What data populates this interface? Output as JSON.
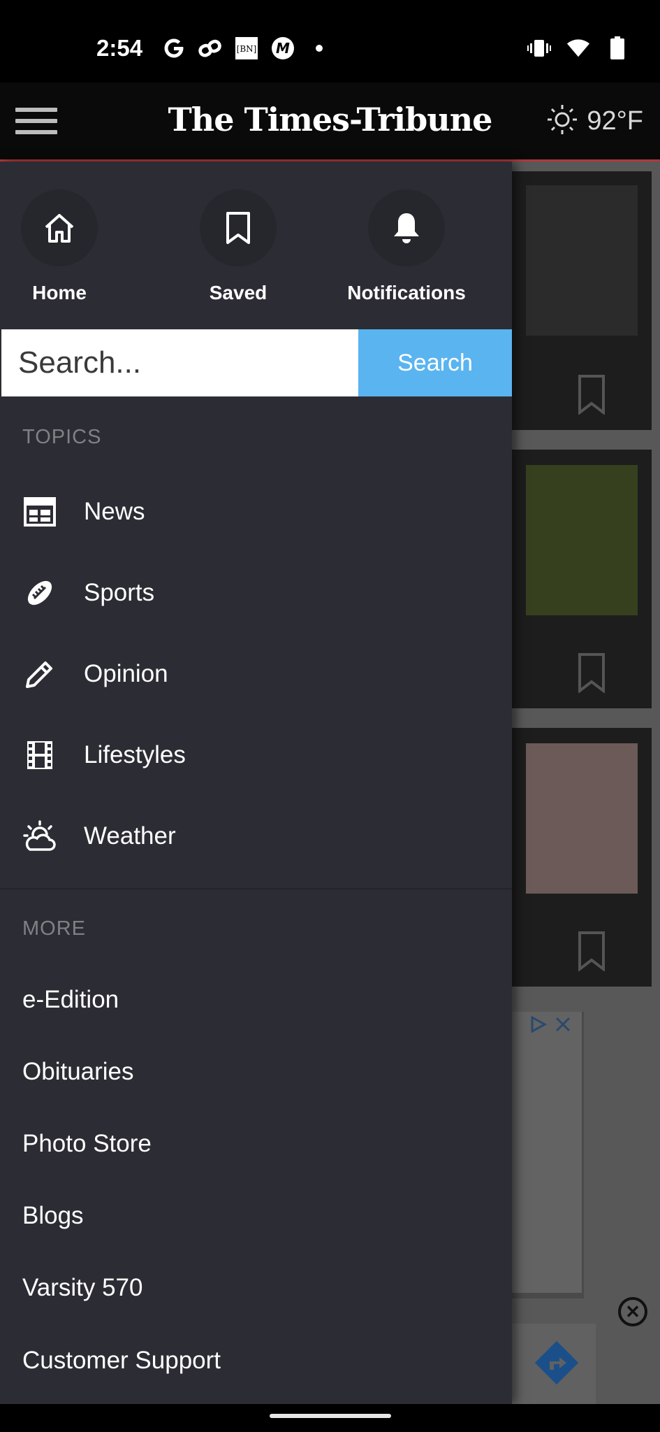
{
  "status_bar": {
    "time": "2:54",
    "left_icons": [
      "google-icon",
      "link-icon",
      "bn-icon",
      "m-icon",
      "dot-icon"
    ],
    "right_icons": [
      "vibrate-icon",
      "wifi-icon",
      "battery-icon"
    ]
  },
  "header": {
    "masthead": "The Times-Tribune",
    "weather_temp": "92°F",
    "accent_color": "#b3373a"
  },
  "drawer": {
    "quick_actions": [
      {
        "label": "Home",
        "icon": "home-icon"
      },
      {
        "label": "Saved",
        "icon": "bookmark-icon"
      },
      {
        "label": "Notifications",
        "icon": "bell-icon"
      }
    ],
    "search": {
      "placeholder": "Search...",
      "button_label": "Search",
      "button_color": "#5ab4f0"
    },
    "topics_heading": "TOPICS",
    "topics": [
      {
        "label": "News",
        "icon": "newspaper-icon"
      },
      {
        "label": "Sports",
        "icon": "football-icon"
      },
      {
        "label": "Opinion",
        "icon": "pencil-icon"
      },
      {
        "label": "Lifestyles",
        "icon": "film-icon"
      },
      {
        "label": "Weather",
        "icon": "weather-icon"
      }
    ],
    "more_heading": "MORE",
    "more_items": [
      "e-Edition",
      "Obituaries",
      "Photo Store",
      "Blogs",
      "Varsity 570",
      "Customer Support"
    ]
  }
}
